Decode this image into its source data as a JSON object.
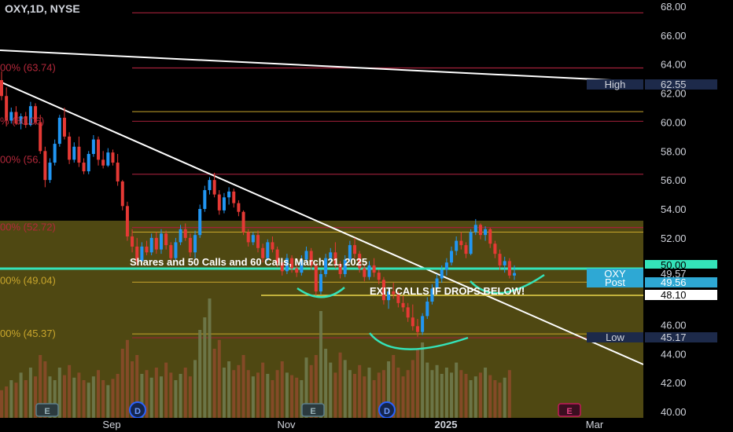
{
  "header": {
    "symbol": "OXY",
    "interval": "1D",
    "exchange": "NYSE"
  },
  "colors": {
    "up": "#2196f3",
    "down": "#e53935",
    "cyan_line": "#34e3b9",
    "fib_red": "#a3213a",
    "fib_gold": "#c9a62c",
    "zone_fill": "#5b5213"
  },
  "chart_data": {
    "type": "candlestick",
    "ylim": [
      40,
      68
    ],
    "y_ticks": [
      "68.00",
      "66.00",
      "64.00",
      "62.00",
      "60.00",
      "58.00",
      "56.00",
      "54.00",
      "52.00",
      "50.00",
      "48.00",
      "46.00",
      "44.00",
      "42.00",
      "40.00"
    ],
    "x_ticks": [
      "Sep",
      "Nov",
      "2025",
      "Mar"
    ],
    "fib_labels": [
      {
        "text": "00% (63.74)",
        "price": 63.74
      },
      {
        "text": "% (60.06)",
        "price": 60.06
      },
      {
        "text": "00% (56.",
        "price": 57.4
      },
      {
        "text": "00% (52.72)",
        "price": 52.72
      },
      {
        "text": "00% (49.04)",
        "price": 49.04
      },
      {
        "text": "00% (45.37)",
        "price": 45.37
      }
    ],
    "price_tags": [
      {
        "label": "High",
        "value": "62.55",
        "price": 62.55
      },
      {
        "label": "",
        "value": "50.00",
        "price": 50.0
      },
      {
        "label": "OXY",
        "value": "49.57",
        "price": 49.57
      },
      {
        "label": "Post",
        "value": "49.56",
        "price": 49.56
      },
      {
        "label": "",
        "value": "48.10",
        "price": 48.1
      },
      {
        "label": "Low",
        "value": "45.17",
        "price": 45.17
      }
    ],
    "annotations": [
      "Shares and 50 Calls and 60 Calls, March 21, 2025",
      "EXIT CALLS IF DROPS BELOW!"
    ],
    "event_markers": [
      "E",
      "D",
      "E",
      "D",
      "E"
    ],
    "candles": [
      {
        "o": 62.9,
        "h": 63.5,
        "l": 61.5,
        "c": 61.8
      },
      {
        "o": 61.8,
        "h": 62.4,
        "l": 59.7,
        "c": 60.1
      },
      {
        "o": 60.1,
        "h": 61.0,
        "l": 59.9,
        "c": 60.7
      },
      {
        "o": 60.7,
        "h": 61.1,
        "l": 59.8,
        "c": 59.9
      },
      {
        "o": 59.9,
        "h": 60.6,
        "l": 59.5,
        "c": 60.4
      },
      {
        "o": 60.4,
        "h": 60.7,
        "l": 59.6,
        "c": 59.8
      },
      {
        "o": 59.8,
        "h": 61.4,
        "l": 59.7,
        "c": 61.1
      },
      {
        "o": 61.1,
        "h": 61.3,
        "l": 59.8,
        "c": 60.0
      },
      {
        "o": 60.0,
        "h": 60.5,
        "l": 57.8,
        "c": 58.0
      },
      {
        "o": 58.0,
        "h": 58.3,
        "l": 55.5,
        "c": 56.0
      },
      {
        "o": 56.0,
        "h": 57.5,
        "l": 55.8,
        "c": 57.2
      },
      {
        "o": 57.2,
        "h": 58.8,
        "l": 57.0,
        "c": 58.5
      },
      {
        "o": 58.5,
        "h": 60.5,
        "l": 58.3,
        "c": 60.3
      },
      {
        "o": 60.3,
        "h": 61.0,
        "l": 58.8,
        "c": 59.0
      },
      {
        "o": 59.0,
        "h": 59.3,
        "l": 57.1,
        "c": 57.4
      },
      {
        "o": 57.4,
        "h": 58.6,
        "l": 57.2,
        "c": 58.3
      },
      {
        "o": 58.3,
        "h": 59.0,
        "l": 56.9,
        "c": 57.2
      },
      {
        "o": 57.2,
        "h": 57.5,
        "l": 56.4,
        "c": 56.6
      },
      {
        "o": 56.6,
        "h": 58.0,
        "l": 56.4,
        "c": 57.8
      },
      {
        "o": 57.8,
        "h": 59.1,
        "l": 57.6,
        "c": 58.8
      },
      {
        "o": 58.8,
        "h": 59.0,
        "l": 57.0,
        "c": 57.4
      },
      {
        "o": 57.4,
        "h": 58.0,
        "l": 56.8,
        "c": 57.0
      },
      {
        "o": 57.0,
        "h": 58.2,
        "l": 56.9,
        "c": 57.9
      },
      {
        "o": 57.9,
        "h": 58.1,
        "l": 57.0,
        "c": 57.2
      },
      {
        "o": 57.2,
        "h": 57.8,
        "l": 55.6,
        "c": 55.9
      },
      {
        "o": 55.9,
        "h": 56.0,
        "l": 53.9,
        "c": 54.2
      },
      {
        "o": 54.2,
        "h": 54.5,
        "l": 51.8,
        "c": 52.1
      },
      {
        "o": 52.1,
        "h": 52.6,
        "l": 51.0,
        "c": 51.4
      },
      {
        "o": 51.4,
        "h": 52.0,
        "l": 50.1,
        "c": 50.4
      },
      {
        "o": 50.4,
        "h": 51.7,
        "l": 50.3,
        "c": 51.4
      },
      {
        "o": 51.4,
        "h": 51.8,
        "l": 50.8,
        "c": 51.0
      },
      {
        "o": 51.0,
        "h": 52.3,
        "l": 50.8,
        "c": 52.0
      },
      {
        "o": 52.0,
        "h": 52.4,
        "l": 50.9,
        "c": 51.2
      },
      {
        "o": 51.2,
        "h": 52.6,
        "l": 50.9,
        "c": 52.3
      },
      {
        "o": 52.3,
        "h": 52.5,
        "l": 51.2,
        "c": 51.5
      },
      {
        "o": 51.5,
        "h": 51.7,
        "l": 50.3,
        "c": 50.6
      },
      {
        "o": 50.6,
        "h": 52.0,
        "l": 50.4,
        "c": 51.7
      },
      {
        "o": 51.7,
        "h": 52.9,
        "l": 51.5,
        "c": 52.6
      },
      {
        "o": 52.6,
        "h": 53.0,
        "l": 51.8,
        "c": 52.0
      },
      {
        "o": 52.0,
        "h": 52.3,
        "l": 50.7,
        "c": 51.0
      },
      {
        "o": 51.0,
        "h": 52.5,
        "l": 50.6,
        "c": 52.2
      },
      {
        "o": 52.2,
        "h": 54.3,
        "l": 52.0,
        "c": 54.0
      },
      {
        "o": 54.0,
        "h": 55.6,
        "l": 53.8,
        "c": 55.3
      },
      {
        "o": 55.3,
        "h": 56.2,
        "l": 55.0,
        "c": 56.0
      },
      {
        "o": 56.0,
        "h": 56.5,
        "l": 54.8,
        "c": 55.0
      },
      {
        "o": 55.0,
        "h": 55.3,
        "l": 53.6,
        "c": 53.9
      },
      {
        "o": 53.9,
        "h": 55.1,
        "l": 53.7,
        "c": 54.8
      },
      {
        "o": 54.8,
        "h": 55.5,
        "l": 54.3,
        "c": 55.2
      },
      {
        "o": 55.2,
        "h": 55.4,
        "l": 54.1,
        "c": 54.4
      },
      {
        "o": 54.4,
        "h": 54.6,
        "l": 53.5,
        "c": 53.8
      },
      {
        "o": 53.8,
        "h": 53.9,
        "l": 52.2,
        "c": 52.4
      },
      {
        "o": 52.4,
        "h": 52.6,
        "l": 51.4,
        "c": 51.7
      },
      {
        "o": 51.7,
        "h": 52.4,
        "l": 51.5,
        "c": 52.2
      },
      {
        "o": 52.2,
        "h": 52.5,
        "l": 51.0,
        "c": 51.3
      },
      {
        "o": 51.3,
        "h": 51.6,
        "l": 50.3,
        "c": 50.6
      },
      {
        "o": 50.6,
        "h": 51.9,
        "l": 50.4,
        "c": 51.7
      },
      {
        "o": 51.7,
        "h": 52.1,
        "l": 51.0,
        "c": 51.2
      },
      {
        "o": 51.2,
        "h": 51.4,
        "l": 50.0,
        "c": 50.3
      },
      {
        "o": 50.3,
        "h": 50.6,
        "l": 49.4,
        "c": 49.7
      },
      {
        "o": 49.7,
        "h": 50.9,
        "l": 49.5,
        "c": 50.6
      },
      {
        "o": 50.6,
        "h": 50.8,
        "l": 49.6,
        "c": 49.9
      },
      {
        "o": 49.9,
        "h": 50.2,
        "l": 49.3,
        "c": 49.6
      },
      {
        "o": 49.6,
        "h": 50.8,
        "l": 49.4,
        "c": 50.5
      },
      {
        "o": 50.5,
        "h": 51.4,
        "l": 50.3,
        "c": 51.1
      },
      {
        "o": 51.1,
        "h": 51.3,
        "l": 49.8,
        "c": 50.1
      },
      {
        "o": 50.1,
        "h": 50.3,
        "l": 48.0,
        "c": 48.3
      },
      {
        "o": 48.3,
        "h": 49.8,
        "l": 48.1,
        "c": 49.5
      },
      {
        "o": 49.5,
        "h": 50.9,
        "l": 49.3,
        "c": 50.6
      },
      {
        "o": 50.6,
        "h": 51.3,
        "l": 50.2,
        "c": 51.0
      },
      {
        "o": 51.0,
        "h": 51.7,
        "l": 49.9,
        "c": 50.2
      },
      {
        "o": 50.2,
        "h": 50.4,
        "l": 49.2,
        "c": 49.5
      },
      {
        "o": 49.5,
        "h": 50.8,
        "l": 49.3,
        "c": 50.5
      },
      {
        "o": 50.5,
        "h": 51.8,
        "l": 50.3,
        "c": 51.5
      },
      {
        "o": 51.5,
        "h": 52.0,
        "l": 50.6,
        "c": 50.9
      },
      {
        "o": 50.9,
        "h": 51.1,
        "l": 49.6,
        "c": 49.9
      },
      {
        "o": 49.9,
        "h": 50.2,
        "l": 49.0,
        "c": 49.3
      },
      {
        "o": 49.3,
        "h": 50.4,
        "l": 49.1,
        "c": 50.1
      },
      {
        "o": 50.1,
        "h": 50.6,
        "l": 49.3,
        "c": 49.6
      },
      {
        "o": 49.6,
        "h": 49.8,
        "l": 48.8,
        "c": 49.1
      },
      {
        "o": 49.1,
        "h": 49.3,
        "l": 47.4,
        "c": 47.7
      },
      {
        "o": 47.7,
        "h": 48.6,
        "l": 47.1,
        "c": 48.3
      },
      {
        "o": 48.3,
        "h": 48.9,
        "l": 47.8,
        "c": 48.1
      },
      {
        "o": 48.1,
        "h": 48.3,
        "l": 47.2,
        "c": 47.5
      },
      {
        "o": 47.5,
        "h": 48.0,
        "l": 46.9,
        "c": 47.2
      },
      {
        "o": 47.2,
        "h": 47.5,
        "l": 46.2,
        "c": 46.5
      },
      {
        "o": 46.5,
        "h": 47.4,
        "l": 45.6,
        "c": 45.9
      },
      {
        "o": 45.9,
        "h": 46.4,
        "l": 45.17,
        "c": 45.5
      },
      {
        "o": 45.5,
        "h": 46.8,
        "l": 45.3,
        "c": 46.6
      },
      {
        "o": 46.6,
        "h": 47.9,
        "l": 46.4,
        "c": 47.6
      },
      {
        "o": 47.6,
        "h": 48.8,
        "l": 47.4,
        "c": 48.5
      },
      {
        "o": 48.5,
        "h": 49.5,
        "l": 48.3,
        "c": 49.2
      },
      {
        "o": 49.2,
        "h": 50.1,
        "l": 48.9,
        "c": 49.8
      },
      {
        "o": 49.8,
        "h": 50.6,
        "l": 49.4,
        "c": 50.3
      },
      {
        "o": 50.3,
        "h": 51.4,
        "l": 50.1,
        "c": 51.1
      },
      {
        "o": 51.1,
        "h": 52.1,
        "l": 50.8,
        "c": 51.8
      },
      {
        "o": 51.8,
        "h": 52.4,
        "l": 51.2,
        "c": 51.5
      },
      {
        "o": 51.5,
        "h": 51.7,
        "l": 50.6,
        "c": 50.9
      },
      {
        "o": 50.9,
        "h": 52.6,
        "l": 50.8,
        "c": 52.4
      },
      {
        "o": 52.4,
        "h": 53.3,
        "l": 52.2,
        "c": 52.9
      },
      {
        "o": 52.9,
        "h": 53.0,
        "l": 51.9,
        "c": 52.2
      },
      {
        "o": 52.2,
        "h": 52.8,
        "l": 51.8,
        "c": 52.6
      },
      {
        "o": 52.6,
        "h": 52.7,
        "l": 51.3,
        "c": 51.6
      },
      {
        "o": 51.6,
        "h": 51.8,
        "l": 50.6,
        "c": 50.9
      },
      {
        "o": 50.9,
        "h": 51.2,
        "l": 49.8,
        "c": 50.1
      },
      {
        "o": 50.1,
        "h": 50.7,
        "l": 49.6,
        "c": 50.4
      },
      {
        "o": 50.4,
        "h": 50.6,
        "l": 49.2,
        "c": 49.4
      },
      {
        "o": 49.4,
        "h": 50.1,
        "l": 49.1,
        "c": 49.57
      }
    ],
    "volumes": [
      0.22,
      0.25,
      0.3,
      0.28,
      0.36,
      0.3,
      0.4,
      0.33,
      0.5,
      0.45,
      0.33,
      0.3,
      0.4,
      0.34,
      0.42,
      0.32,
      0.36,
      0.3,
      0.28,
      0.33,
      0.38,
      0.3,
      0.26,
      0.31,
      0.35,
      0.55,
      0.62,
      0.45,
      0.5,
      0.35,
      0.38,
      0.32,
      0.4,
      0.33,
      0.44,
      0.36,
      0.3,
      0.35,
      0.4,
      0.33,
      0.46,
      0.7,
      0.8,
      0.95,
      0.55,
      0.62,
      0.4,
      0.45,
      0.38,
      0.42,
      0.5,
      0.38,
      0.33,
      0.36,
      0.44,
      0.35,
      0.3,
      0.38,
      0.45,
      0.36,
      0.34,
      0.32,
      0.3,
      0.48,
      0.42,
      0.5,
      0.85,
      0.55,
      0.44,
      0.36,
      0.52,
      0.46,
      0.38,
      0.35,
      0.42,
      0.33,
      0.4,
      0.3,
      0.36,
      0.38,
      0.45,
      0.5,
      0.4,
      0.33,
      0.38,
      0.46,
      0.55,
      0.6,
      0.44,
      0.38,
      0.42,
      0.35,
      0.4,
      0.36,
      0.44,
      0.38,
      0.35,
      0.3,
      0.33,
      0.36,
      0.4,
      0.34,
      0.3,
      0.28,
      0.32,
      0.38
    ]
  }
}
